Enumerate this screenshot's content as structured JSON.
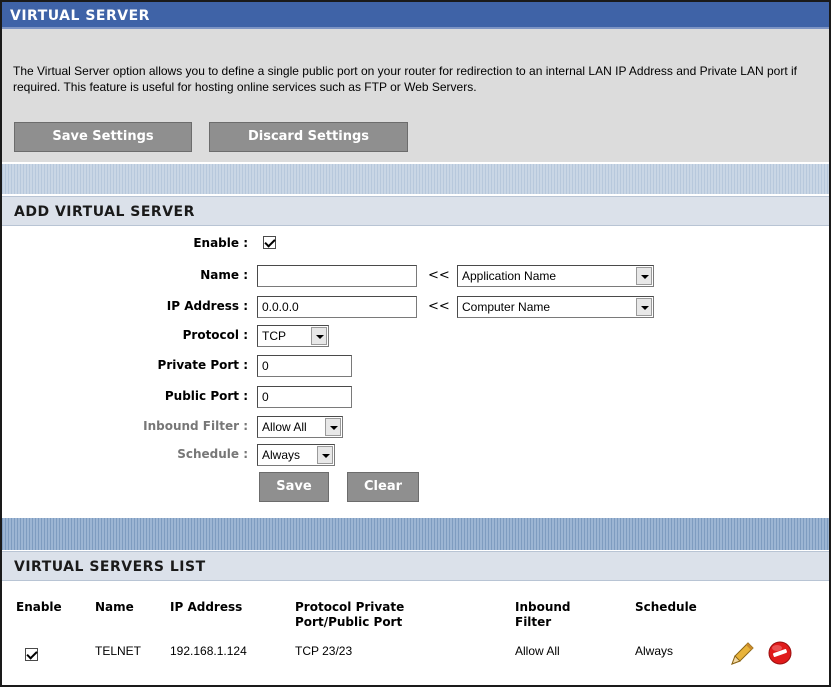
{
  "header": {
    "title": "VIRTUAL SERVER",
    "description": "The Virtual Server option allows you to define a single public port on your router for redirection to an internal LAN IP Address and Private LAN port if required. This feature is useful for hosting online services such as FTP or Web Servers.",
    "save_settings_label": "Save Settings",
    "discard_settings_label": "Discard Settings"
  },
  "add_section": {
    "title": "ADD VIRTUAL SERVER",
    "enable_label": "Enable :",
    "enable_checked": true,
    "name_label": "Name :",
    "name_value": "",
    "name_chevron": "<<",
    "application_select": "Application Name",
    "ip_label": "IP Address :",
    "ip_value": "0.0.0.0",
    "ip_chevron": "<<",
    "computer_select": "Computer Name",
    "protocol_label": "Protocol :",
    "protocol_value": "TCP",
    "private_port_label": "Private Port :",
    "private_port_value": "0",
    "public_port_label": "Public Port :",
    "public_port_value": "0",
    "inbound_filter_label": "Inbound Filter :",
    "inbound_filter_value": "Allow All",
    "schedule_label": "Schedule :",
    "schedule_value": "Always",
    "save_label": "Save",
    "clear_label": "Clear"
  },
  "list_section": {
    "title": "VIRTUAL SERVERS LIST",
    "columns": {
      "enable": "Enable",
      "name": "Name",
      "ip_address": "IP Address",
      "protocol_line1": "Protocol Private",
      "protocol_line2": "Port/Public Port",
      "inbound_line1": "Inbound",
      "inbound_line2": "Filter",
      "schedule": "Schedule"
    },
    "rows": [
      {
        "enabled": true,
        "name": "TELNET",
        "ip_address": "192.168.1.124",
        "protocol_port": "TCP 23/23",
        "inbound_filter": "Allow All",
        "schedule": "Always"
      }
    ]
  },
  "icons": {
    "edit": "pencil-icon",
    "delete": "delete-icon"
  },
  "colors": {
    "title_bar": "#3f63a7",
    "button": "#8f8f8f",
    "header_bg": "#dcdcdc",
    "section_bar": "#dbe1ea",
    "delete_red": "#e01b1b",
    "pencil_yellow": "#e8b33a"
  }
}
